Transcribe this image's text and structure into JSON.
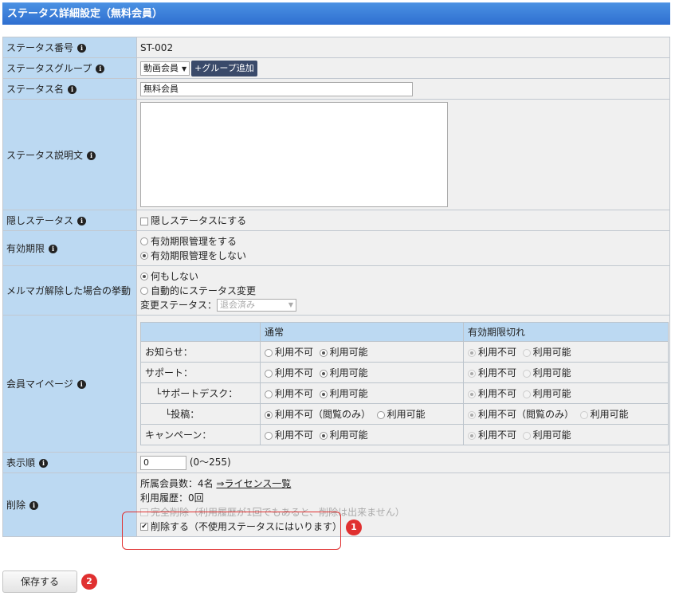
{
  "header": {
    "title": "ステータス詳細設定（無料会員）"
  },
  "rows": {
    "status_no": {
      "label": "ステータス番号",
      "value": "ST-002"
    },
    "group": {
      "label": "ステータスグループ",
      "selected": "動画会員",
      "add_button": "+グループ追加"
    },
    "name": {
      "label": "ステータス名",
      "value": "無料会員"
    },
    "description": {
      "label": "ステータス説明文",
      "value": ""
    },
    "hidden": {
      "label": "隠しステータス",
      "checkbox_label": "隠しステータスにする",
      "checked": false
    },
    "expiry": {
      "label": "有効期限",
      "options": [
        "有効期限管理をする",
        "有効期限管理をしない"
      ],
      "selected_index": 1
    },
    "mailmag": {
      "label": "メルマガ解除した場合の挙動",
      "options": [
        "何もしない",
        "自動的にステータス変更"
      ],
      "selected_index": 0,
      "change_label": "変更ステータス：",
      "change_select": "退会済み"
    },
    "mypage": {
      "label": "会員マイページ",
      "columns": [
        "",
        "通常",
        "有効期限切れ"
      ],
      "rows": [
        {
          "name": "お知らせ：",
          "normal": [
            "利用不可",
            "利用可能"
          ],
          "normal_sel": 1,
          "expired": [
            "利用不可",
            "利用可能"
          ],
          "expired_sel": 0
        },
        {
          "name": "サポート：",
          "normal": [
            "利用不可",
            "利用可能"
          ],
          "normal_sel": 1,
          "expired": [
            "利用不可",
            "利用可能"
          ],
          "expired_sel": 0
        },
        {
          "name": "└サポートデスク：",
          "normal": [
            "利用不可",
            "利用可能"
          ],
          "normal_sel": 1,
          "expired": [
            "利用不可",
            "利用可能"
          ],
          "expired_sel": 0
        },
        {
          "name": "└投稿：",
          "normal": [
            "利用不可（閲覧のみ）",
            "利用可能"
          ],
          "normal_sel": 0,
          "expired": [
            "利用不可（閲覧のみ）",
            "利用可能"
          ],
          "expired_sel": 0
        },
        {
          "name": "キャンペーン：",
          "normal": [
            "利用不可",
            "利用可能"
          ],
          "normal_sel": 1,
          "expired": [
            "利用不可",
            "利用可能"
          ],
          "expired_sel": 0
        }
      ]
    },
    "order": {
      "label": "表示順",
      "value": "0",
      "range": "(0～255)"
    },
    "delete": {
      "label": "削除",
      "members_text": "所属会員数：4名",
      "license_link": "⇒ライセンス一覧",
      "history": "利用履歴：0回",
      "full_delete": "完全削除（利用履歴が1回でもあると、削除は出来ません）",
      "delete_label": "削除する（不使用ステータスにはいります）",
      "delete_checked": true
    }
  },
  "annotations": {
    "badge1": "1",
    "badge2": "2"
  },
  "footer": {
    "save_label": "保存する"
  },
  "colors": {
    "header_blue": "#2f6fd0",
    "label_bg": "#bcd9f2",
    "highlight_red": "#e03030"
  }
}
